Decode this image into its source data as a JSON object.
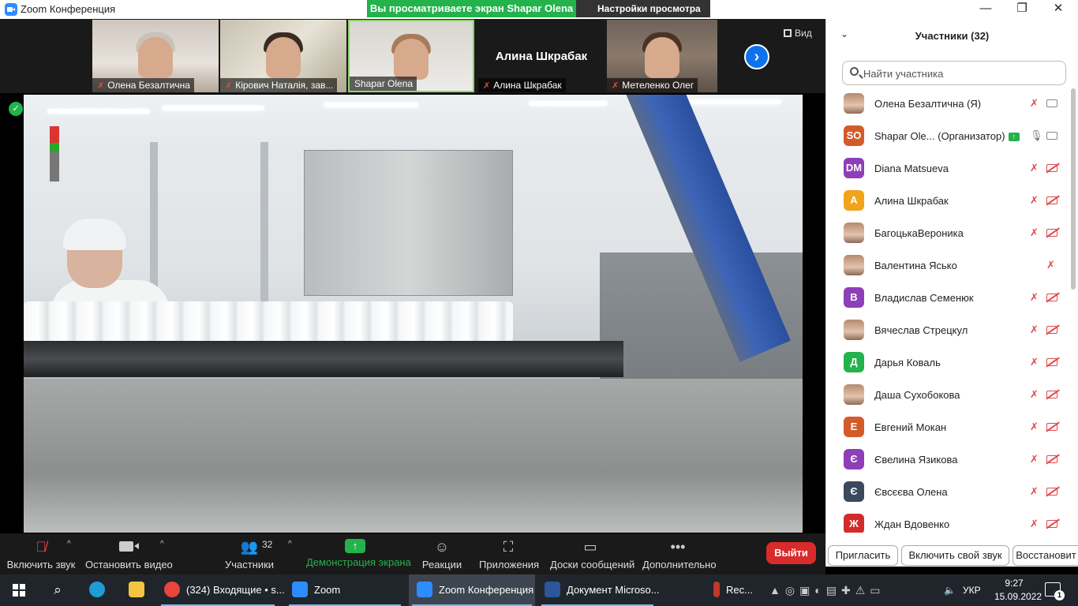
{
  "window": {
    "title": "Zoom Конференция",
    "minimize": "—",
    "restore": "❐",
    "close": "✕"
  },
  "banner": {
    "sharing_text": "Вы просматриваете экран Shapar Olena",
    "view_settings": "Настройки просмотра",
    "view_settings_caret": "⌄"
  },
  "thumbnails": [
    {
      "name": "Олена Безалтична",
      "muted": true,
      "has_video": true,
      "hair_color": "#c9c2b8"
    },
    {
      "name": "Кірович Наталія, зав...",
      "muted": true,
      "has_video": true,
      "hair_color": "#3b2a22"
    },
    {
      "name": "Shapar Olena",
      "muted": false,
      "has_video": true,
      "active": true,
      "hair_color": "#a77b5c"
    },
    {
      "name": "Алина Шкрабак",
      "muted": true,
      "has_video": false
    },
    {
      "name": "Метеленко Олег",
      "muted": true,
      "has_video": true,
      "hair_color": "#4a3325"
    }
  ],
  "strip": {
    "next_icon": "›",
    "view_label": "Вид"
  },
  "toolbar": {
    "unmute": "Включить звук",
    "stop_video": "Остановить видео",
    "participants": "Участники",
    "participants_count": "32",
    "share_screen": "Демонстрация экрана",
    "share_icon": "↑",
    "reactions": "Реакции",
    "apps": "Приложения",
    "whiteboards": "Доски сообщений",
    "more": "Дополнительно",
    "more_icon": "•••",
    "caret": "^",
    "leave": "Выйти"
  },
  "panel": {
    "title": "Участники (32)",
    "collapse_icon": "⌄",
    "search_placeholder": "Найти участника",
    "participants": [
      {
        "name": "Олена Безалтична",
        "role": "(Я)",
        "avatar_type": "photo",
        "mic": "off",
        "cam": "on"
      },
      {
        "name": "Shapar Ole...",
        "role": "(Организатор)",
        "avatar_text": "SO",
        "avatar_color": "#D35B29",
        "sharing": true,
        "mic": "on",
        "cam": "on"
      },
      {
        "name": "Diana Matsueva",
        "avatar_text": "DM",
        "avatar_color": "#8E3FB8",
        "mic": "off",
        "cam": "off"
      },
      {
        "name": "Алина Шкрабак",
        "avatar_text": "А",
        "avatar_color": "#F0A31B",
        "mic": "off",
        "cam": "off"
      },
      {
        "name": "БагоцькаВероника",
        "avatar_type": "photo",
        "mic": "off",
        "cam": "off"
      },
      {
        "name": "Валентина Ясько",
        "avatar_type": "photo",
        "mic": "off",
        "cam": "none"
      },
      {
        "name": "Владислав Семенюк",
        "avatar_text": "В",
        "avatar_color": "#8E3FB8",
        "mic": "off",
        "cam": "off"
      },
      {
        "name": "Вячеслав Стрецкул",
        "avatar_type": "photo",
        "mic": "off",
        "cam": "off"
      },
      {
        "name": "Дарья Коваль",
        "avatar_text": "Д",
        "avatar_color": "#23B24B",
        "mic": "off",
        "cam": "off"
      },
      {
        "name": "Даша Сухобокова",
        "avatar_type": "photo",
        "mic": "off",
        "cam": "off"
      },
      {
        "name": "Евгений Мокан",
        "avatar_text": "Е",
        "avatar_color": "#D35B29",
        "mic": "off",
        "cam": "off"
      },
      {
        "name": "Євелина Язикова",
        "avatar_text": "Є",
        "avatar_color": "#8E3FB8",
        "mic": "off",
        "cam": "off"
      },
      {
        "name": "Євсєєва Олена",
        "avatar_text": "Є",
        "avatar_color": "#3a4a5c",
        "mic": "off",
        "cam": "off"
      },
      {
        "name": "Ждан Вдовенко",
        "avatar_text": "Ж",
        "avatar_color": "#D32B2B",
        "mic": "off",
        "cam": "off"
      }
    ],
    "invite": "Пригласить",
    "unmute_me": "Включить свой звук",
    "restore": "Восстановит"
  },
  "taskbar": {
    "items": [
      {
        "label": "(324) Входящие • s...",
        "icon_color": "#e8453c"
      },
      {
        "label": "Zoom",
        "icon_color": "#2D8CFF"
      },
      {
        "label": "Zoom Конференция",
        "icon_color": "#2D8CFF",
        "active": true
      },
      {
        "label": "Документ Microso...",
        "icon_color": "#2B579A"
      },
      {
        "label": "Rec...",
        "icon_color": "#c0392b"
      }
    ],
    "lang": "УКР",
    "time": "9:27",
    "date": "15.09.2022",
    "notifications": "1"
  }
}
